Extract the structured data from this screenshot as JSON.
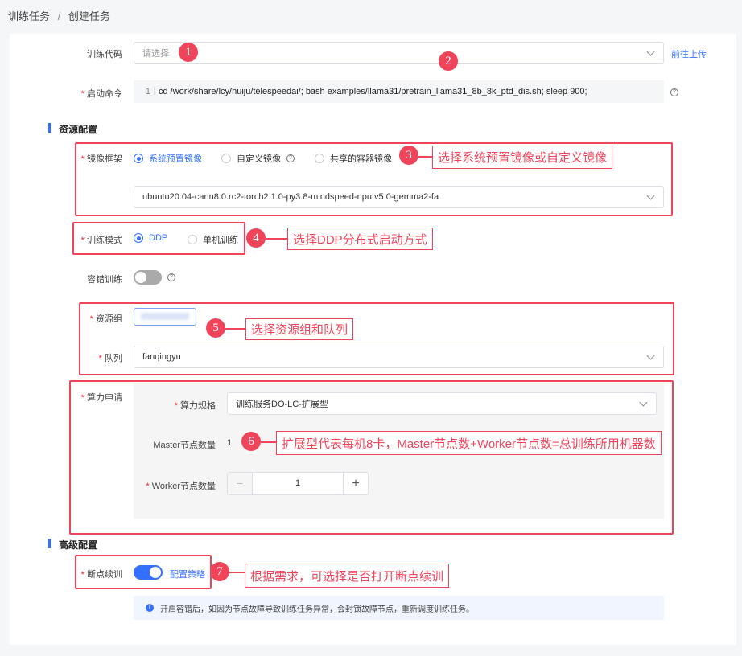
{
  "breadcrumb": {
    "parent": "训练任务",
    "sep": "/",
    "current": "创建任务"
  },
  "form": {
    "code": {
      "label": "训练代码",
      "placeholder": "请选择",
      "link": "前往上传"
    },
    "command": {
      "label": "启动命令",
      "line_no": "1",
      "value": "cd /work/share/lcy/huiju/telespeedai/; bash examples/llama31/pretrain_llama31_8b_8k_ptd_dis.sh; sleep 900;"
    },
    "resource_section": "资源配置",
    "image": {
      "label": "镜像框架",
      "options": [
        "系统预置镜像",
        "自定义镜像",
        "共享的容器镜像"
      ],
      "selected": "系统预置镜像",
      "value": "ubuntu20.04-cann8.0.rc2-torch2.1.0-py3.8-mindspeed-npu:v5.0-gemma2-fa"
    },
    "mode": {
      "label": "训练模式",
      "options": [
        "DDP",
        "单机训练"
      ],
      "selected": "DDP"
    },
    "fault": {
      "label": "容错训练",
      "enabled": false
    },
    "group": {
      "label": "资源组"
    },
    "queue": {
      "label": "队列",
      "value": "fanqingyu"
    },
    "compute": {
      "label": "算力申请",
      "spec_label": "算力规格",
      "spec_value": "训练服务DO-LC-扩展型",
      "master_label": "Master节点数量",
      "master_value": "1",
      "worker_label": "Worker节点数量",
      "worker_value": "1",
      "minus": "−",
      "plus": "+"
    },
    "advanced_section": "高级配置",
    "resume": {
      "label": "断点续训",
      "enabled": true,
      "link": "配置策略"
    },
    "info": "开启容错后，如因为节点故障导致训练任务异常，会封锁故障节点，重新调度训练任务。"
  },
  "annotations": {
    "n1": "1",
    "n2": "2",
    "n3": "3",
    "n4": "4",
    "n5": "5",
    "n6": "6",
    "n7": "7",
    "c3": "选择系统预置镜像或自定义镜像",
    "c4": "选择DDP分布式启动方式",
    "c5": "选择资源组和队列",
    "c6": "扩展型代表每机8卡，Master节点数+Worker节点数=总训练所用机器数",
    "c7": "根据需求，可选择是否打开断点续训"
  },
  "colors": {
    "primary": "#3370ff",
    "annotation": "#f0445b"
  }
}
